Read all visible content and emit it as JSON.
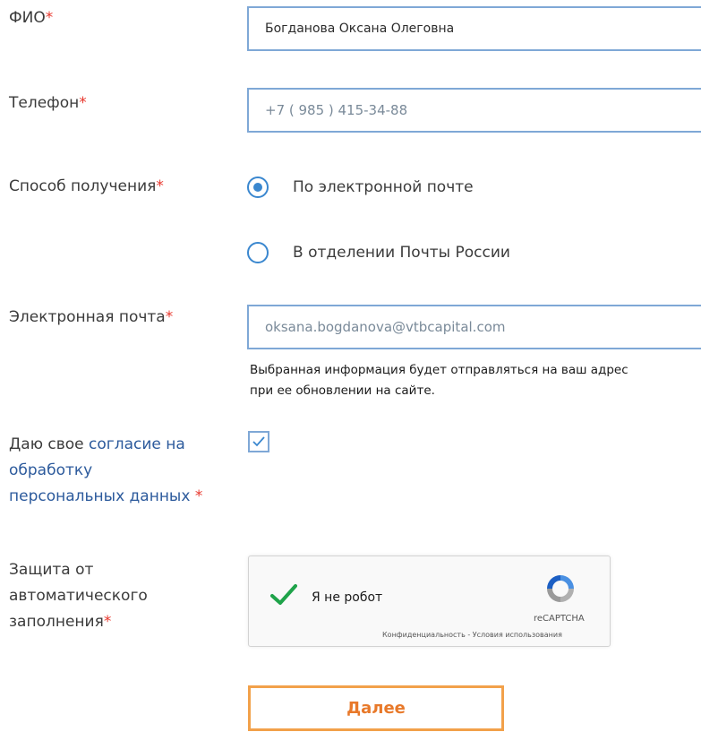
{
  "form": {
    "fio": {
      "label": "ФИО",
      "required": "*",
      "value": "Богданова Оксана Олеговна"
    },
    "phone": {
      "label": "Телефон",
      "required": "*",
      "value": "+7 ( 985 ) 415-34-88"
    },
    "delivery": {
      "label": "Способ получения",
      "required": "*",
      "options": [
        {
          "label": "По электронной почте",
          "selected": true
        },
        {
          "label": "В отделении Почты России",
          "selected": false
        }
      ]
    },
    "email": {
      "label": "Электронная почта",
      "required": "*",
      "value": "oksana.bogdanova@vtbcapital.com",
      "hint_line1": "Выбранная информация будет отправляться на ваш адрес",
      "hint_line2": "при ее обновлении на сайте."
    },
    "consent": {
      "prefix": "Даю свое ",
      "link_line1": "согласие на",
      "link_line2": "обработку",
      "link_line3": "персональных данных",
      "required": " *",
      "checked": true
    },
    "captcha": {
      "label_line1": "Защита от",
      "label_line2": "автоматического",
      "label_line3": "заполнения",
      "required": "*",
      "checkbox_text": "Я не робот",
      "brand": "reCAPTCHA",
      "terms": "Конфиденциальность - Условия использования"
    },
    "submit_label": "Далее"
  },
  "colors": {
    "accent": "#3a87cf",
    "required": "#e8372d",
    "link": "#2c5a9c",
    "button": "#f2a14a",
    "check": "#1fa34a"
  }
}
